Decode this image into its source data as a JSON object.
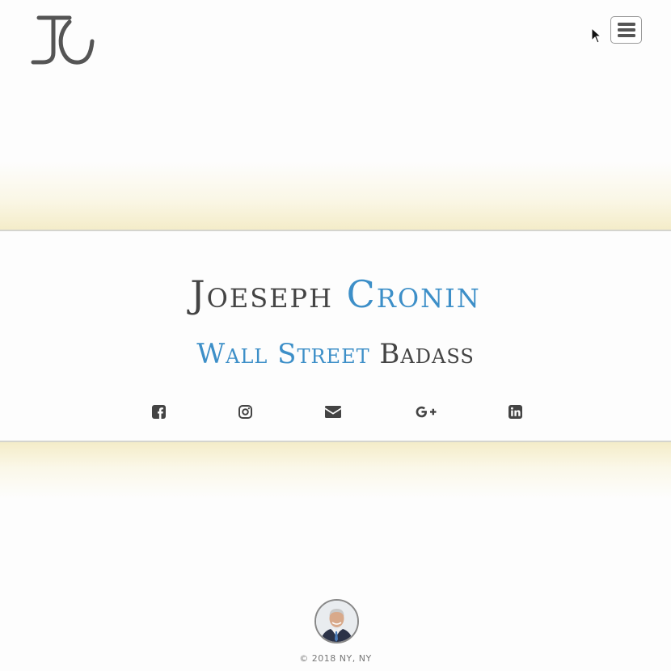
{
  "header": {
    "logo_icon": "jc-monogram-logo",
    "menu_icon": "hamburger-menu-icon"
  },
  "hero": {
    "name_first": "Joeseph",
    "name_last": "Cronin",
    "tagline_accent": "Wall Street",
    "tagline_rest": "Badass"
  },
  "social": [
    {
      "icon": "facebook-icon"
    },
    {
      "icon": "instagram-icon"
    },
    {
      "icon": "envelope-icon"
    },
    {
      "icon": "google-plus-icon"
    },
    {
      "icon": "linkedin-icon"
    }
  ],
  "footer": {
    "avatar_icon": "profile-photo",
    "copyright": "© 2018 NY, NY"
  },
  "colors": {
    "accent": "#3d8fc8",
    "text": "#444444",
    "glow": "#f4ecc8"
  }
}
